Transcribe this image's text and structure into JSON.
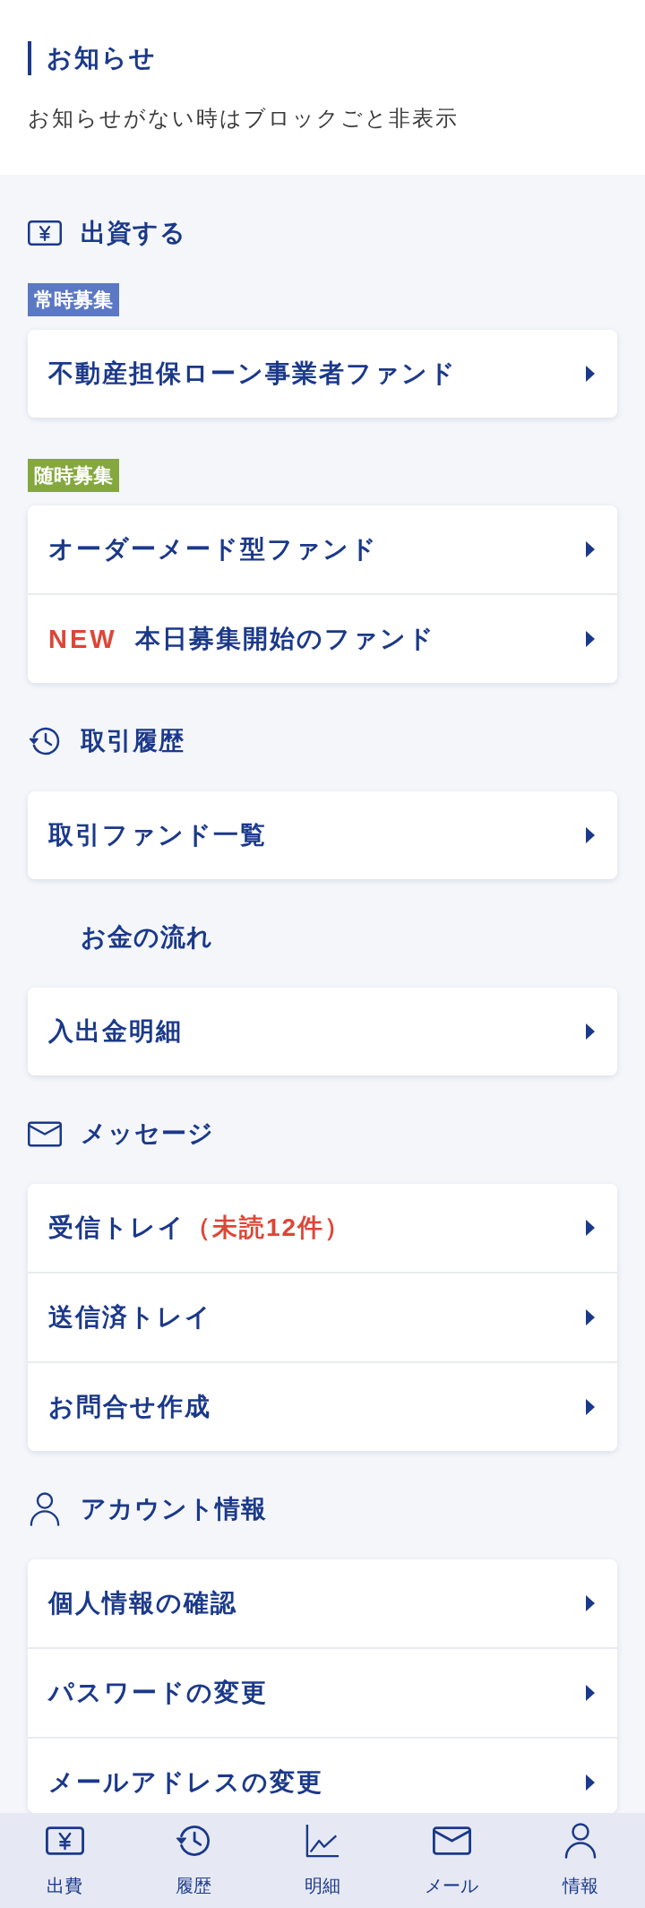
{
  "notice": {
    "title": "お知らせ",
    "body": "お知らせがない時はブロックごと非表示"
  },
  "sections": [
    {
      "kind": "invest",
      "title": "出資する",
      "groups": [
        {
          "badge": {
            "label": "常時募集",
            "color": "#5b78c4"
          },
          "items": [
            {
              "label": "不動産担保ローン事業者ファンド"
            }
          ]
        },
        {
          "badge": {
            "label": "随時募集",
            "color": "#84a83e"
          },
          "items": [
            {
              "label": "オーダーメード型ファンド"
            },
            {
              "tag": "NEW",
              "label": "本日募集開始のファンド"
            }
          ]
        }
      ]
    },
    {
      "kind": "history",
      "title": "取引履歴",
      "groups": [
        {
          "items": [
            {
              "label": "取引ファンド一覧"
            }
          ]
        }
      ]
    },
    {
      "kind": "cashflow",
      "title": "お金の流れ",
      "groups": [
        {
          "items": [
            {
              "label": "入出金明細"
            }
          ]
        }
      ]
    },
    {
      "kind": "message",
      "title": "メッセージ",
      "groups": [
        {
          "items": [
            {
              "label": "受信トレイ",
              "note": "（未読12件）"
            },
            {
              "label": "送信済トレイ"
            },
            {
              "label": "お問合せ作成"
            }
          ]
        }
      ]
    },
    {
      "kind": "account",
      "title": "アカウント情報",
      "groups": [
        {
          "items": [
            {
              "label": "個人情報の確認"
            },
            {
              "label": "パスワードの変更"
            },
            {
              "label": "メールアドレスの変更"
            }
          ]
        }
      ]
    }
  ],
  "nav": [
    {
      "kind": "invest",
      "label": "出費"
    },
    {
      "kind": "history",
      "label": "履歴"
    },
    {
      "kind": "statement",
      "label": "明細"
    },
    {
      "kind": "message",
      "label": "メール"
    },
    {
      "kind": "account",
      "label": "情報"
    }
  ]
}
